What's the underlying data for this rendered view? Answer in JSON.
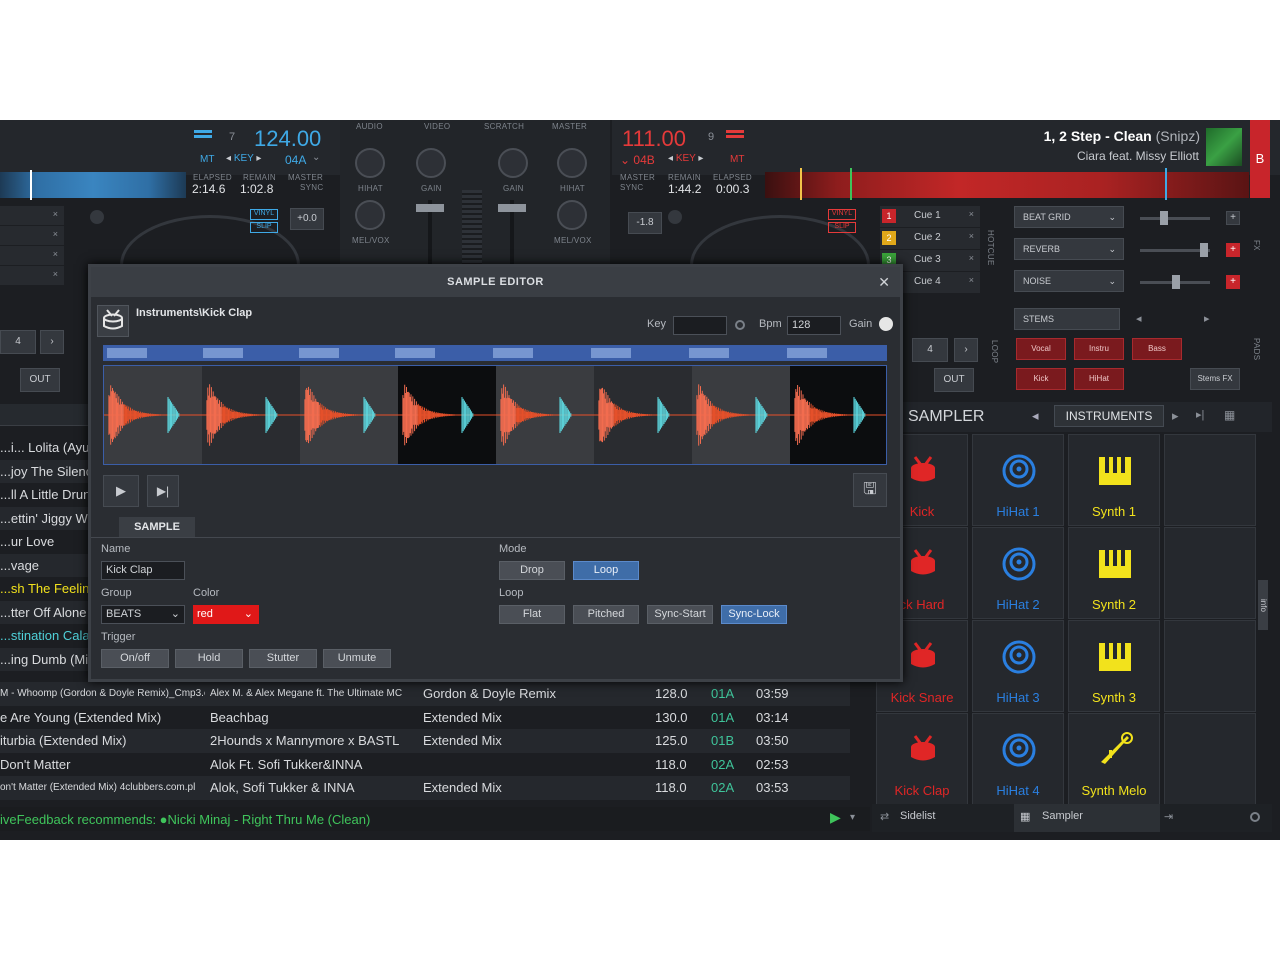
{
  "deck_left": {
    "bpm": "124.00",
    "pitch_value": "7",
    "mt_label": "MT",
    "key_label": "KEY",
    "key_value": "04A",
    "elapsed_label": "ELAPSED",
    "elapsed": "2:14.6",
    "remain_label": "REMAIN",
    "remain": "1:02.8",
    "master_label": "MASTER",
    "sync_label": "SYNC",
    "vinyl_label": "VINYL",
    "slip_label": "SLIP",
    "pitch_readout": "+0.0",
    "loop_value": "4",
    "out_label": "OUT"
  },
  "deck_right": {
    "bpm": "111.00",
    "pitch_value": "9",
    "key_value": "04B",
    "key_label": "KEY",
    "mt_label": "MT",
    "master_label": "MASTER",
    "sync_label": "SYNC",
    "remain_label": "REMAIN",
    "remain": "1:44.2",
    "elapsed_label": "ELAPSED",
    "elapsed": "0:00.3",
    "vinyl_label": "VINYL",
    "slip_label": "SLIP",
    "pitch_readout": "-1.8",
    "loop_value": "4",
    "out_label": "OUT",
    "track_title": "1, 2 Step",
    "track_mix": "- Clean",
    "track_mix_extra": "(Snipz)",
    "track_artist": "Ciara feat. Missy Elliott",
    "deck_letter": "B"
  },
  "mixer": {
    "tabs": [
      "AUDIO",
      "VIDEO",
      "SCRATCH",
      "MASTER"
    ],
    "hihat": "HIHAT",
    "gain": "GAIN",
    "melvox": "MEL/VOX"
  },
  "cues": [
    {
      "num": "1",
      "label": "Cue 1",
      "color": "#c8252b"
    },
    {
      "num": "2",
      "label": "Cue 2",
      "color": "#e0a81a"
    },
    {
      "num": "3",
      "label": "Cue 3",
      "color": "#3aa33a"
    },
    {
      "num": "4",
      "label": "Cue 4",
      "color": "#2c6fcf"
    }
  ],
  "hotcue_label": "HOTCUE",
  "fx": {
    "slots": [
      "BEAT GRID",
      "REVERB",
      "NOISE"
    ],
    "side_label": "FX",
    "stems_label": "STEMS",
    "stem_pads": [
      "Vocal",
      "Instru",
      "Bass",
      "Kick",
      "HiHat"
    ],
    "stems_fx": "Stems FX",
    "pads_label": "PADS",
    "loop_label": "LOOP"
  },
  "editor": {
    "title": "SAMPLE EDITOR",
    "path": "Instruments\\Kick Clap",
    "key_label": "Key",
    "bpm_label": "Bpm",
    "bpm_value": "128",
    "gain_label": "Gain",
    "tab_sample": "SAMPLE",
    "name_label": "Name",
    "name_value": "Kick Clap",
    "group_label": "Group",
    "group_value": "BEATS",
    "color_label": "Color",
    "color_value": "red",
    "trigger_label": "Trigger",
    "trigger_buttons": [
      "On/off",
      "Hold",
      "Stutter",
      "Unmute"
    ],
    "mode_label": "Mode",
    "mode_buttons": [
      "Drop",
      "Loop"
    ],
    "loop_label": "Loop",
    "loop_buttons": [
      "Flat",
      "Pitched",
      "Sync-Start",
      "Sync-Lock"
    ]
  },
  "browser": {
    "left_titles": [
      "...i... Lolita (Ayur",
      "...joy The Silence",
      "...ll A Little Drunk",
      "...ettin' Jiggy Wit i",
      "...ur Love",
      "...vage",
      "...sh The Feeling",
      "...tter Off Alone",
      "...stination Calab",
      "...ing Dumb (Mik"
    ],
    "rows": [
      {
        "title": "M - Whoomp (Gordon & Doyle Remix)_Cmp3.eu",
        "artist": "Alex M. & Alex Megane ft. The Ultimate MC",
        "remix": "Gordon & Doyle Remix",
        "bpm": "128.0",
        "key": "01A",
        "length": "03:59"
      },
      {
        "title": "e Are Young (Extended Mix)",
        "artist": "Beachbag",
        "remix": "Extended Mix",
        "bpm": "130.0",
        "key": "01A",
        "length": "03:14"
      },
      {
        "title": "iturbia (Extended Mix)",
        "artist": "2Hounds x Mannymore x BASTL",
        "remix": "Extended Mix",
        "bpm": "125.0",
        "key": "01B",
        "length": "03:50"
      },
      {
        "title": "Don't Matter",
        "artist": "Alok Ft. Sofi Tukker&INNA",
        "remix": "",
        "bpm": "118.0",
        "key": "02A",
        "length": "02:53"
      },
      {
        "title": "on't Matter (Extended Mix) 4clubbers.com.pl",
        "artist": "Alok, Sofi Tukker & INNA",
        "remix": "Extended Mix",
        "bpm": "118.0",
        "key": "02A",
        "length": "03:53"
      }
    ],
    "livefeedback": "iveFeedback recommends: ●Nicki Minaj - Right Thru Me (Clean)"
  },
  "sampler": {
    "title": "SAMPLER",
    "bank": "INSTRUMENTS",
    "pads": [
      {
        "label": "Kick",
        "kind": "drum"
      },
      {
        "label": "HiHat 1",
        "kind": "hihat"
      },
      {
        "label": "Synth 1",
        "kind": "synth"
      },
      {
        "label": "",
        "kind": "empty"
      },
      {
        "label": "ck Hard",
        "kind": "drum"
      },
      {
        "label": "HiHat 2",
        "kind": "hihat"
      },
      {
        "label": "Synth 2",
        "kind": "synth"
      },
      {
        "label": "",
        "kind": "empty"
      },
      {
        "label": "Kick Snare",
        "kind": "drum"
      },
      {
        "label": "HiHat 3",
        "kind": "hihat"
      },
      {
        "label": "Synth 3",
        "kind": "synth"
      },
      {
        "label": "",
        "kind": "empty"
      },
      {
        "label": "Kick Clap",
        "kind": "drum"
      },
      {
        "label": "HiHat 4",
        "kind": "hihat"
      },
      {
        "label": "Synth Melo",
        "kind": "trumpet"
      },
      {
        "label": "",
        "kind": "empty"
      }
    ],
    "sidelist": "Sidelist",
    "sampler_tab": "Sampler",
    "info": "info"
  },
  "colors": {
    "blue": "#3fa9e6",
    "red": "#e53a3a",
    "yellow": "#f2e21c",
    "pad_red": "#e02626",
    "pad_blue": "#2a7fe0"
  }
}
